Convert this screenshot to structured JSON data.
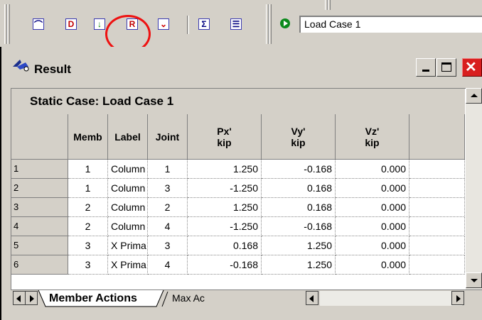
{
  "toolbar": {
    "buttons": [
      {
        "name": "arch-icon",
        "glyph": "⌒",
        "color": "#000080"
      },
      {
        "name": "d-icon",
        "glyph": "D",
        "color": "#c00000"
      },
      {
        "name": "down-arrow-icon",
        "glyph": "↓",
        "color": "#008000"
      },
      {
        "name": "r-icon",
        "glyph": "R",
        "color": "#c00000"
      },
      {
        "name": "deflection-icon",
        "glyph": "⌄",
        "color": "#d00000"
      },
      {
        "name": "sigma-icon",
        "glyph": "Σ",
        "color": "#000080"
      },
      {
        "name": "report-icon",
        "glyph": "☰",
        "color": "#000080"
      }
    ],
    "load_case": "Load Case 1"
  },
  "window": {
    "title": "Result"
  },
  "grid": {
    "case_title": "Static Case: Load Case 1",
    "headers": [
      "Memb",
      "Label",
      "Joint",
      "Px'\nkip",
      "Vy'\nkip",
      "Vz'\nkip"
    ],
    "rows": [
      {
        "id": "1",
        "memb": "1",
        "label": "Column",
        "joint": "1",
        "px": "1.250",
        "vy": "-0.168",
        "vz": "0.000"
      },
      {
        "id": "2",
        "memb": "1",
        "label": "Column",
        "joint": "3",
        "px": "-1.250",
        "vy": "0.168",
        "vz": "0.000"
      },
      {
        "id": "3",
        "memb": "2",
        "label": "Column",
        "joint": "2",
        "px": "1.250",
        "vy": "0.168",
        "vz": "0.000"
      },
      {
        "id": "4",
        "memb": "2",
        "label": "Column",
        "joint": "4",
        "px": "-1.250",
        "vy": "-0.168",
        "vz": "0.000"
      },
      {
        "id": "5",
        "memb": "3",
        "label": "X Prima",
        "joint": "3",
        "px": "0.168",
        "vy": "1.250",
        "vz": "0.000"
      },
      {
        "id": "6",
        "memb": "3",
        "label": "X Prima",
        "joint": "4",
        "px": "-0.168",
        "vy": "1.250",
        "vz": "0.000"
      }
    ]
  },
  "tabs": {
    "active": "Member Actions",
    "next": "Max Ac"
  },
  "colors": {
    "highlight": "#e11111",
    "chrome": "#d4d0c8",
    "close": "#d81f1f"
  }
}
